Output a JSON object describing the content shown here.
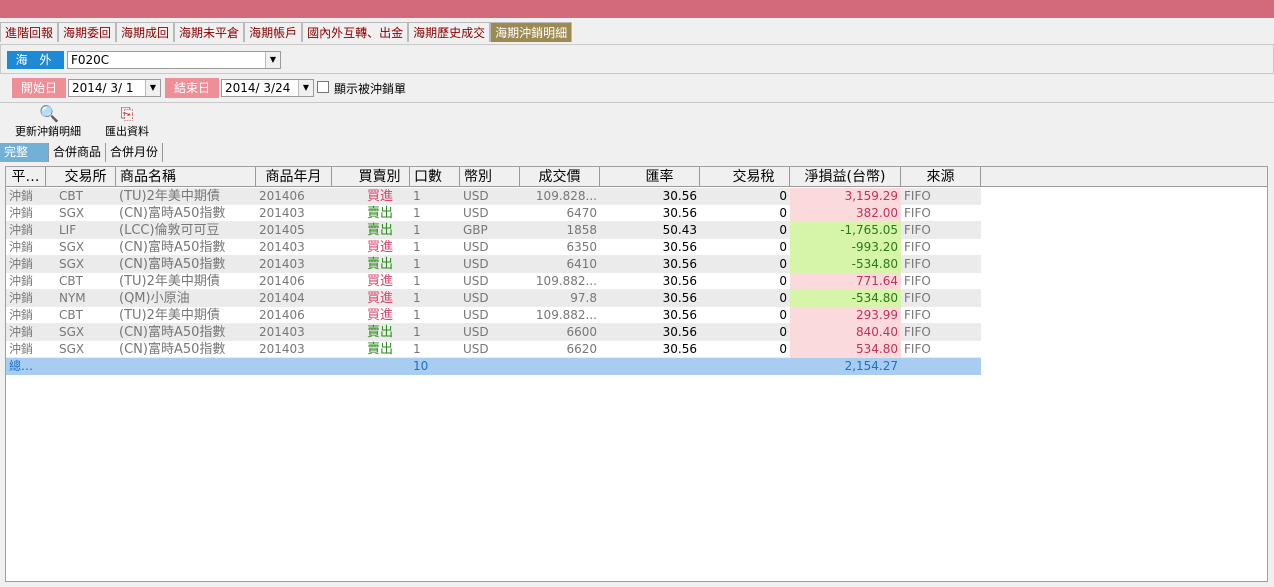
{
  "tabs": [
    "進階回報",
    "海期委回",
    "海期成回",
    "海期未平倉",
    "海期帳戶",
    "國內外互轉、出金",
    "海期歷史成交",
    "海期沖銷明細"
  ],
  "active_tab_index": 7,
  "account": {
    "market_label": "海 外",
    "account_value": "F020C"
  },
  "date_filter": {
    "start_label": "開始日",
    "start_value": "2014/ 3/ 1",
    "end_label": "結束日",
    "end_value": "2014/ 3/24",
    "checkbox_label": "顯示被沖銷單",
    "checkbox_checked": false
  },
  "toolbar": {
    "refresh_label": "更新沖銷明細",
    "export_label": "匯出資料"
  },
  "subtabs": [
    "完整",
    "合併商品",
    "合併月份"
  ],
  "active_subtab_index": 0,
  "table": {
    "headers": [
      "平…",
      "交易所",
      "商品名稱",
      "商品年月",
      "買賣別",
      "口數",
      "幣別",
      "成交價",
      "匯率",
      "交易稅",
      "淨損益(台幣)",
      "來源"
    ],
    "rows": [
      {
        "type": "沖銷",
        "exchange": "CBT",
        "product": "(TU)2年美中期債",
        "month": "201406",
        "side": "買進",
        "qty": "1",
        "currency": "USD",
        "price": "109.828...",
        "rate": "30.56",
        "tax": "0",
        "pnl": "3,159.29",
        "source": "FIFO"
      },
      {
        "type": "沖銷",
        "exchange": "SGX",
        "product": "(CN)富時A50指數",
        "month": "201403",
        "side": "賣出",
        "qty": "1",
        "currency": "USD",
        "price": "6470",
        "rate": "30.56",
        "tax": "0",
        "pnl": "382.00",
        "source": "FIFO"
      },
      {
        "type": "沖銷",
        "exchange": "LIF",
        "product": "(LCC)倫敦可可豆",
        "month": "201405",
        "side": "賣出",
        "qty": "1",
        "currency": "GBP",
        "price": "1858",
        "rate": "50.43",
        "tax": "0",
        "pnl": "-1,765.05",
        "source": "FIFO"
      },
      {
        "type": "沖銷",
        "exchange": "SGX",
        "product": "(CN)富時A50指數",
        "month": "201403",
        "side": "買進",
        "qty": "1",
        "currency": "USD",
        "price": "6350",
        "rate": "30.56",
        "tax": "0",
        "pnl": "-993.20",
        "source": "FIFO"
      },
      {
        "type": "沖銷",
        "exchange": "SGX",
        "product": "(CN)富時A50指數",
        "month": "201403",
        "side": "賣出",
        "qty": "1",
        "currency": "USD",
        "price": "6410",
        "rate": "30.56",
        "tax": "0",
        "pnl": "-534.80",
        "source": "FIFO"
      },
      {
        "type": "沖銷",
        "exchange": "CBT",
        "product": "(TU)2年美中期債",
        "month": "201406",
        "side": "買進",
        "qty": "1",
        "currency": "USD",
        "price": "109.882...",
        "rate": "30.56",
        "tax": "0",
        "pnl": "771.64",
        "source": "FIFO"
      },
      {
        "type": "沖銷",
        "exchange": "NYM",
        "product": "(QM)小原油",
        "month": "201404",
        "side": "買進",
        "qty": "1",
        "currency": "USD",
        "price": "97.8",
        "rate": "30.56",
        "tax": "0",
        "pnl": "-534.80",
        "source": "FIFO"
      },
      {
        "type": "沖銷",
        "exchange": "CBT",
        "product": "(TU)2年美中期債",
        "month": "201406",
        "side": "買進",
        "qty": "1",
        "currency": "USD",
        "price": "109.882...",
        "rate": "30.56",
        "tax": "0",
        "pnl": "293.99",
        "source": "FIFO"
      },
      {
        "type": "沖銷",
        "exchange": "SGX",
        "product": "(CN)富時A50指數",
        "month": "201403",
        "side": "賣出",
        "qty": "1",
        "currency": "USD",
        "price": "6600",
        "rate": "30.56",
        "tax": "0",
        "pnl": "840.40",
        "source": "FIFO"
      },
      {
        "type": "沖銷",
        "exchange": "SGX",
        "product": "(CN)富時A50指數",
        "month": "201403",
        "side": "賣出",
        "qty": "1",
        "currency": "USD",
        "price": "6620",
        "rate": "30.56",
        "tax": "0",
        "pnl": "534.80",
        "source": "FIFO"
      }
    ],
    "total": {
      "label": "總…",
      "qty": "10",
      "pnl": "2,154.27"
    }
  },
  "colors": {
    "top_bar": "#d26a7c",
    "active_tab": "#9c8a52",
    "buy": "#d9456a",
    "sell": "#2d8a1e",
    "profit_bg": "#fadadd",
    "loss_bg": "#d6f5a8",
    "total_bg": "#a9cdf1"
  }
}
